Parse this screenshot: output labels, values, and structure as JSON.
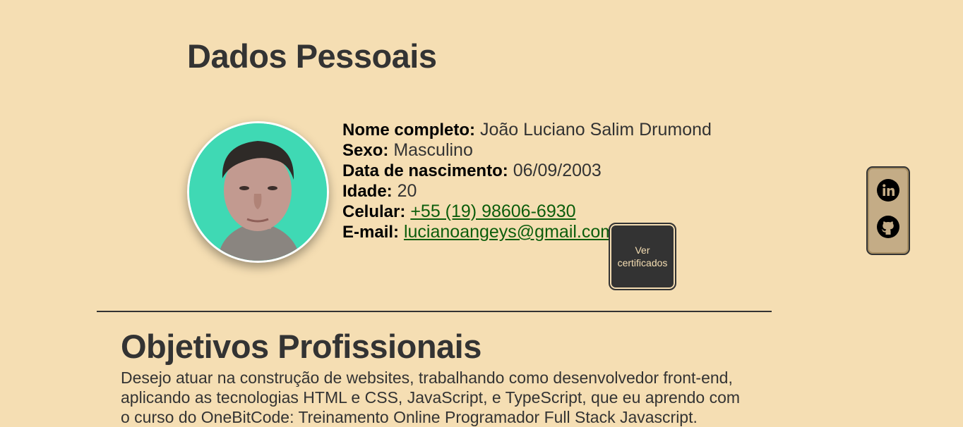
{
  "personal": {
    "title": "Dados Pessoais",
    "fields": [
      {
        "label": "Nome completo:",
        "value": "João Luciano Salim Drumond"
      },
      {
        "label": "Sexo:",
        "value": "Masculino"
      },
      {
        "label": "Data de nascimento:",
        "value": "06/09/2003"
      },
      {
        "label": "Idade:",
        "value": "20"
      }
    ],
    "phone": {
      "label": "Celular:",
      "value": "+55 (19) 98606-6930"
    },
    "email": {
      "label": "E-mail:",
      "value": "lucianoangeys@gmail.com"
    },
    "cert_button": "Ver certificados"
  },
  "social": {
    "icons": [
      "linkedin-icon",
      "github-icon"
    ]
  },
  "objectives": {
    "title": "Objetivos Profissionais",
    "text": "Desejo atuar na construção de websites, trabalhando como desenvolvedor front-end, aplicando as tecnologias HTML e CSS, JavaScript, e TypeScript, que eu aprendo com o curso do OneBitCode: Treinamento Online Programador Full Stack Javascript."
  },
  "colors": {
    "background": "#f5deb3",
    "text": "#333333",
    "link": "#0b5d0b",
    "button_bg": "#333333",
    "social_panel": "#c4ac86"
  }
}
